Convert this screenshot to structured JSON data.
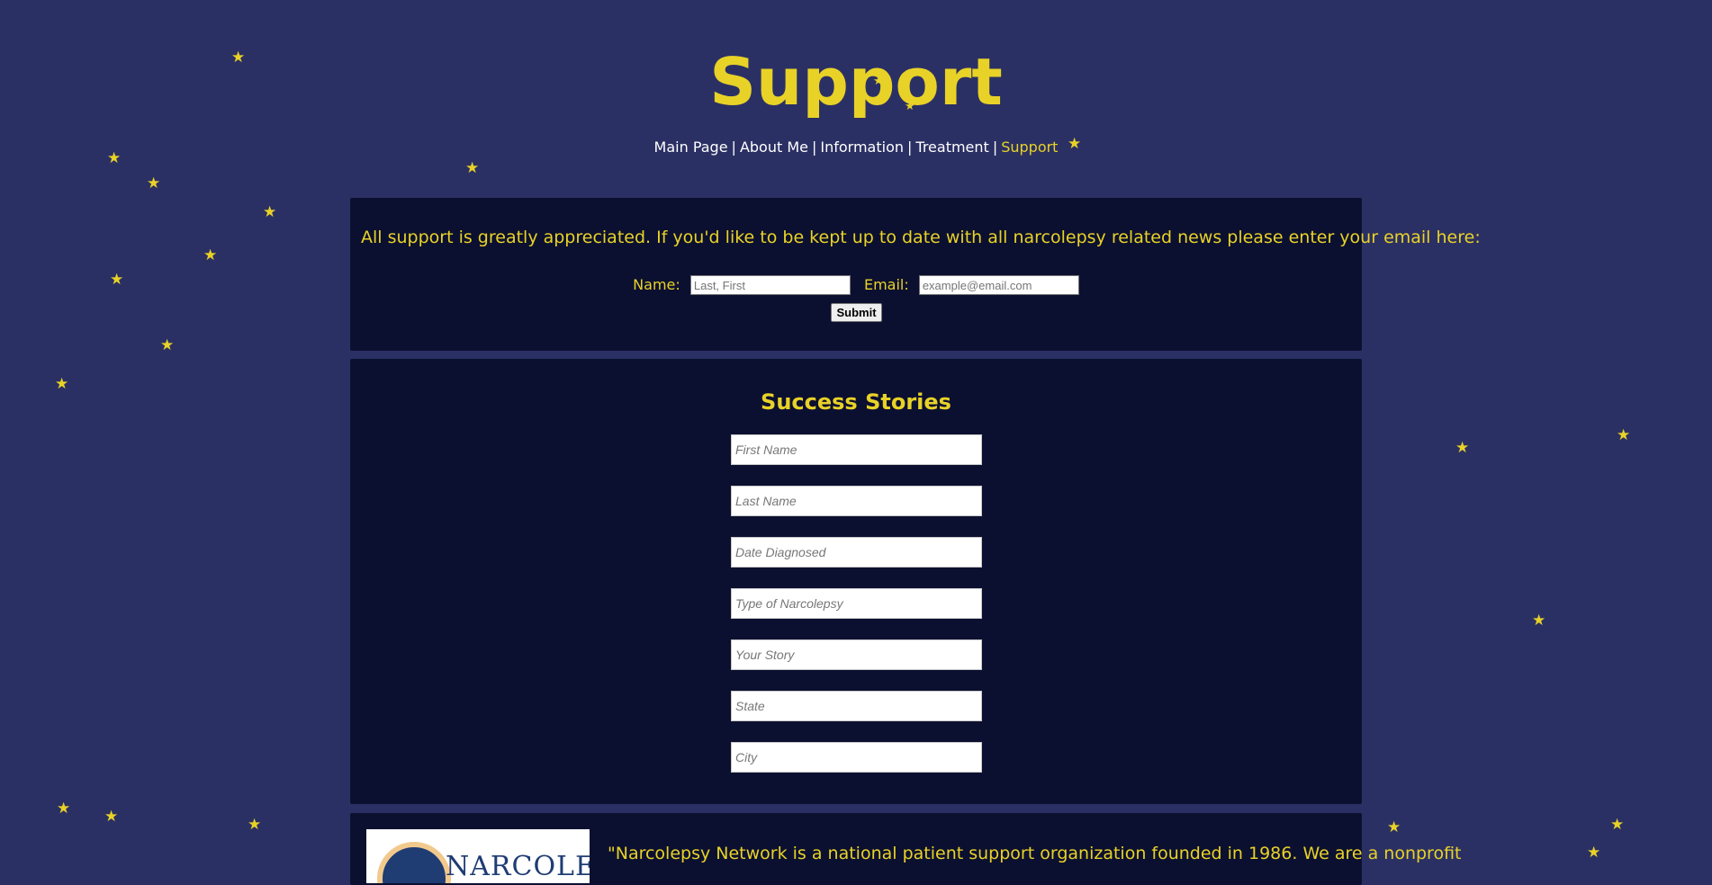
{
  "page": {
    "title": "Support"
  },
  "nav": {
    "items": [
      {
        "label": "Main Page"
      },
      {
        "label": "About Me"
      },
      {
        "label": "Information"
      },
      {
        "label": "Treatment"
      },
      {
        "label": "Support"
      }
    ],
    "separator": "|",
    "active": "Support"
  },
  "newsletter": {
    "intro": "All support is greatly appreciated. If you'd like to be kept up to date with all narcolepsy related news please enter your email here:",
    "name_label": "Name:",
    "name_placeholder": "Last, First",
    "email_label": "Email:",
    "email_placeholder": "example@email.com",
    "submit_label": "Submit"
  },
  "stories": {
    "title": "Success Stories",
    "fields": [
      {
        "placeholder": "First Name"
      },
      {
        "placeholder": "Last Name"
      },
      {
        "placeholder": "Date Diagnosed"
      },
      {
        "placeholder": "Type of Narcolepsy"
      },
      {
        "placeholder": "Your Story"
      },
      {
        "placeholder": "State"
      },
      {
        "placeholder": "City"
      }
    ]
  },
  "partner": {
    "logo_text": "NARCOLEPSY",
    "quote": "\"Narcolepsy Network is a national patient support organization founded in 1986. We are a nonprofit"
  },
  "colors": {
    "background": "#2b3064",
    "panel": "#0c1030",
    "accent": "#e8d227",
    "nav_text": "#ffffff"
  },
  "icons": {
    "decoration": "star-icon"
  }
}
